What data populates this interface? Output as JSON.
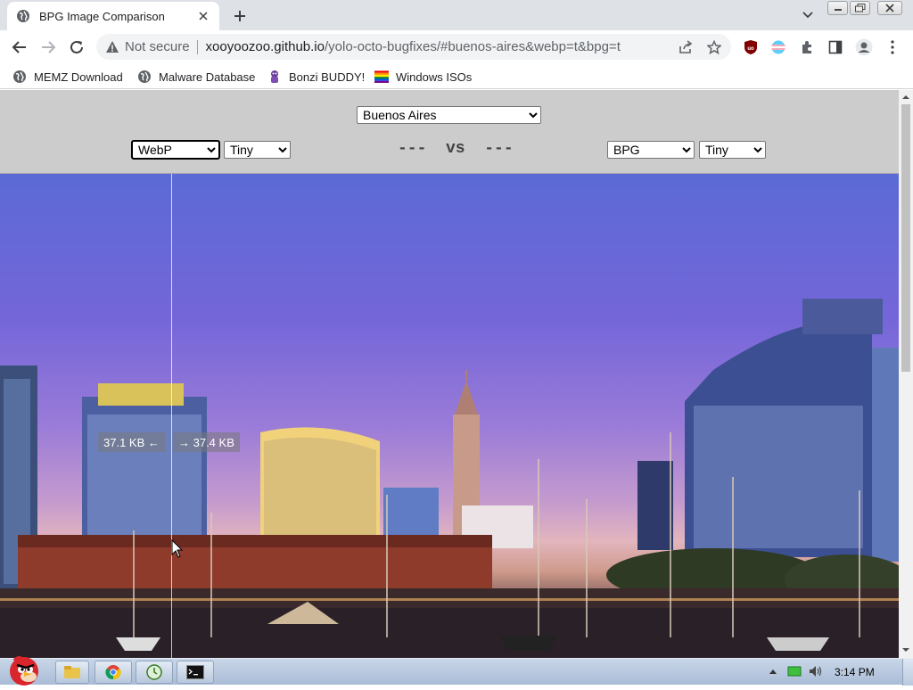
{
  "browser": {
    "tab": {
      "title": "BPG Image Comparison"
    },
    "address": {
      "security": "Not secure",
      "host": "xooyoozoo.github.io",
      "path": "/yolo-octo-bugfixes/#buenos-aires&webp=t&bpg=t"
    },
    "bookmarks": [
      {
        "label": "MEMZ Download",
        "icon": "globe-icon"
      },
      {
        "label": "Malware Database",
        "icon": "globe-icon"
      },
      {
        "label": "Bonzi BUDDY!",
        "icon": "bonzi-icon"
      },
      {
        "label": "Windows ISOs",
        "icon": "rainbow-flag-icon"
      }
    ]
  },
  "page": {
    "image_select": "Buenos Aires",
    "left": {
      "codec": "WebP",
      "size": "Tiny"
    },
    "right": {
      "codec": "BPG",
      "size": "Tiny"
    },
    "vs_text": "---  vs  ---",
    "left_filesize": "37.1 KB ←",
    "right_filesize": "→ 37.4 KB"
  },
  "taskbar": {
    "time": "3:14 PM"
  },
  "colors": {
    "chrome_tabstrip": "#dee1e6",
    "controls_bg": "#cccccc",
    "sky_top": "#5b6ad6",
    "sky_bottom": "#e3b5bd"
  }
}
